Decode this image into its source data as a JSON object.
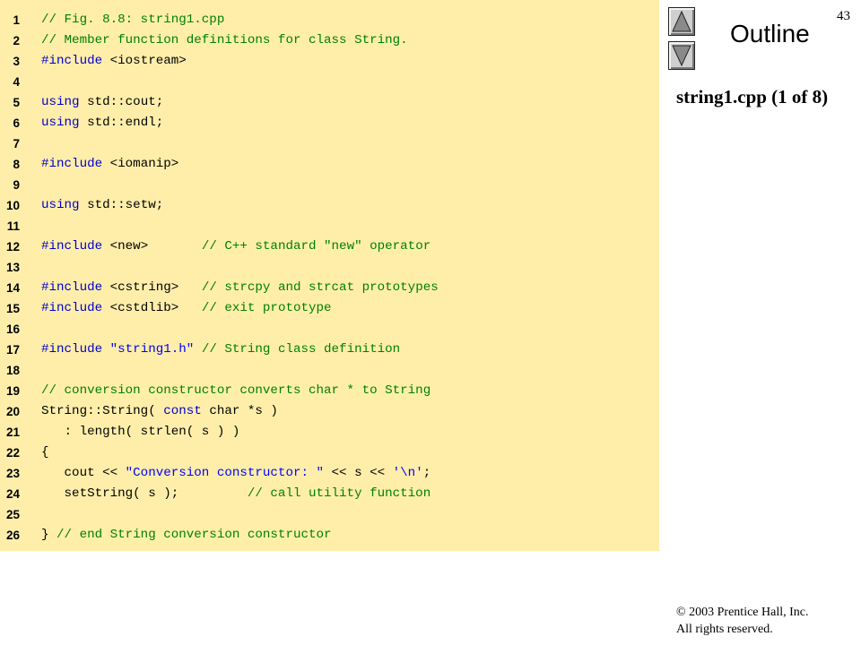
{
  "slide_number": "43",
  "outline_label": "Outline",
  "file_title": "string1.cpp (1 of 8)",
  "copyright": {
    "line1": "© 2003 Prentice Hall, Inc.",
    "line2": "All rights reserved."
  },
  "nav": {
    "up_icon": "triangle-up-icon",
    "down_icon": "triangle-down-icon"
  },
  "colors": {
    "code_background": "#ffeeaa",
    "comment": "#008000",
    "keyword": "#0000cc",
    "string": "#0000ff"
  },
  "code_lines": [
    {
      "n": "1",
      "tokens": [
        {
          "t": "cm",
          "v": "// Fig. 8.8: string1.cpp"
        }
      ]
    },
    {
      "n": "2",
      "tokens": [
        {
          "t": "cm",
          "v": "// Member function definitions for class String."
        }
      ]
    },
    {
      "n": "3",
      "tokens": [
        {
          "t": "kw",
          "v": "#include"
        },
        {
          "t": "pl",
          "v": " <iostream>"
        }
      ]
    },
    {
      "n": "4",
      "tokens": []
    },
    {
      "n": "5",
      "tokens": [
        {
          "t": "kw",
          "v": "using"
        },
        {
          "t": "pl",
          "v": " std::cout;"
        }
      ]
    },
    {
      "n": "6",
      "tokens": [
        {
          "t": "kw",
          "v": "using"
        },
        {
          "t": "pl",
          "v": " std::endl;"
        }
      ]
    },
    {
      "n": "7",
      "tokens": []
    },
    {
      "n": "8",
      "tokens": [
        {
          "t": "kw",
          "v": "#include"
        },
        {
          "t": "pl",
          "v": " <iomanip>"
        }
      ]
    },
    {
      "n": "9",
      "tokens": []
    },
    {
      "n": "10",
      "tokens": [
        {
          "t": "kw",
          "v": "using"
        },
        {
          "t": "pl",
          "v": " std::setw;"
        }
      ]
    },
    {
      "n": "11",
      "tokens": []
    },
    {
      "n": "12",
      "tokens": [
        {
          "t": "kw",
          "v": "#include"
        },
        {
          "t": "pl",
          "v": " <new>       "
        },
        {
          "t": "cm",
          "v": "// C++ standard \"new\" operator"
        }
      ]
    },
    {
      "n": "13",
      "tokens": []
    },
    {
      "n": "14",
      "tokens": [
        {
          "t": "kw",
          "v": "#include"
        },
        {
          "t": "pl",
          "v": " <cstring>   "
        },
        {
          "t": "cm",
          "v": "// strcpy and strcat prototypes"
        }
      ]
    },
    {
      "n": "15",
      "tokens": [
        {
          "t": "kw",
          "v": "#include"
        },
        {
          "t": "pl",
          "v": " <cstdlib>   "
        },
        {
          "t": "cm",
          "v": "// exit prototype"
        }
      ]
    },
    {
      "n": "16",
      "tokens": []
    },
    {
      "n": "17",
      "tokens": [
        {
          "t": "kw",
          "v": "#include"
        },
        {
          "t": "pl",
          "v": " "
        },
        {
          "t": "st",
          "v": "\"string1.h\""
        },
        {
          "t": "pl",
          "v": " "
        },
        {
          "t": "cm",
          "v": "// String class definition"
        }
      ]
    },
    {
      "n": "18",
      "tokens": []
    },
    {
      "n": "19",
      "tokens": [
        {
          "t": "cm",
          "v": "// conversion constructor converts char * to String"
        }
      ]
    },
    {
      "n": "20",
      "tokens": [
        {
          "t": "pl",
          "v": "String::String( "
        },
        {
          "t": "kw",
          "v": "const"
        },
        {
          "t": "pl",
          "v": " char *s )"
        }
      ]
    },
    {
      "n": "21",
      "tokens": [
        {
          "t": "pl",
          "v": "   : length( strlen( s ) )"
        }
      ]
    },
    {
      "n": "22",
      "tokens": [
        {
          "t": "pl",
          "v": "{"
        }
      ]
    },
    {
      "n": "23",
      "tokens": [
        {
          "t": "pl",
          "v": "   cout << "
        },
        {
          "t": "st",
          "v": "\"Conversion constructor: \""
        },
        {
          "t": "pl",
          "v": " << s << "
        },
        {
          "t": "st",
          "v": "'\\n'"
        },
        {
          "t": "pl",
          "v": ";"
        }
      ]
    },
    {
      "n": "24",
      "tokens": [
        {
          "t": "pl",
          "v": "   setString( s );         "
        },
        {
          "t": "cm",
          "v": "// call utility function"
        }
      ]
    },
    {
      "n": "25",
      "tokens": []
    },
    {
      "n": "26",
      "tokens": [
        {
          "t": "pl",
          "v": "} "
        },
        {
          "t": "cm",
          "v": "// end String conversion constructor"
        }
      ]
    }
  ]
}
